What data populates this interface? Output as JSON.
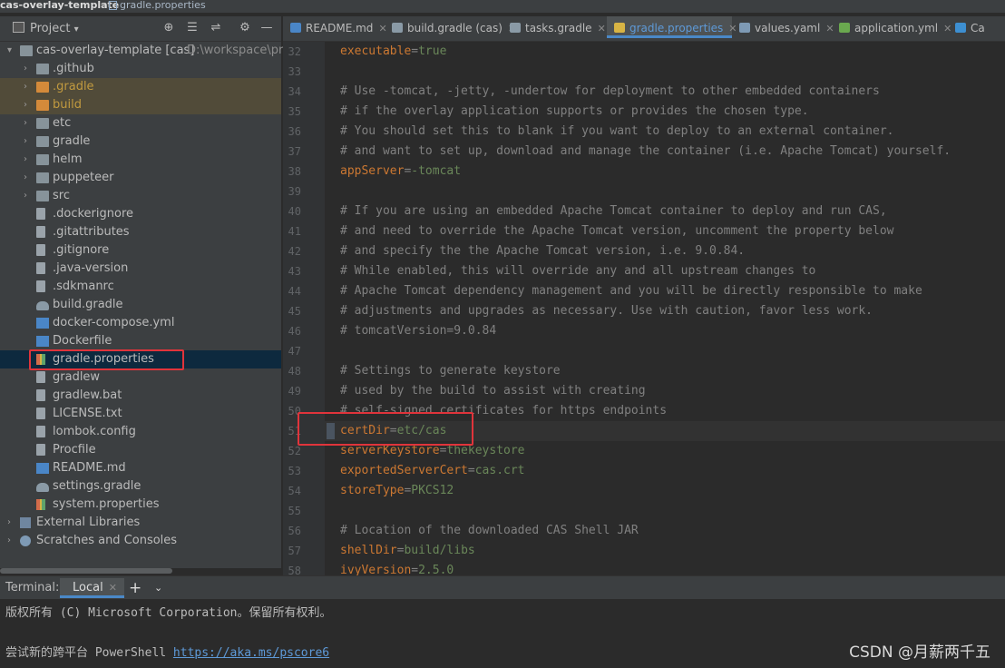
{
  "breadcrumb": {
    "project": "cas-overlay-template",
    "file": "gradle.properties"
  },
  "project_panel": {
    "title": "Project",
    "tree": [
      {
        "label": "cas-overlay-template [cas]",
        "extra": "D:\\workspace\\pro",
        "kind": "root"
      },
      {
        "label": ".github",
        "kind": "folder"
      },
      {
        "label": ".gradle",
        "kind": "folder-excluded"
      },
      {
        "label": "build",
        "kind": "folder-excluded"
      },
      {
        "label": "etc",
        "kind": "folder"
      },
      {
        "label": "gradle",
        "kind": "folder"
      },
      {
        "label": "helm",
        "kind": "folder"
      },
      {
        "label": "puppeteer",
        "kind": "folder"
      },
      {
        "label": "src",
        "kind": "folder"
      },
      {
        "label": ".dockerignore",
        "kind": "file"
      },
      {
        "label": ".gitattributes",
        "kind": "file"
      },
      {
        "label": ".gitignore",
        "kind": "file"
      },
      {
        "label": ".java-version",
        "kind": "file"
      },
      {
        "label": ".sdkmanrc",
        "kind": "file"
      },
      {
        "label": "build.gradle",
        "kind": "gradle"
      },
      {
        "label": "docker-compose.yml",
        "kind": "doc"
      },
      {
        "label": "Dockerfile",
        "kind": "doc"
      },
      {
        "label": "gradle.properties",
        "kind": "props-selected"
      },
      {
        "label": "gradlew",
        "kind": "file"
      },
      {
        "label": "gradlew.bat",
        "kind": "file"
      },
      {
        "label": "LICENSE.txt",
        "kind": "file"
      },
      {
        "label": "lombok.config",
        "kind": "file"
      },
      {
        "label": "Procfile",
        "kind": "file"
      },
      {
        "label": "README.md",
        "kind": "doc"
      },
      {
        "label": "settings.gradle",
        "kind": "gradle"
      },
      {
        "label": "system.properties",
        "kind": "props"
      },
      {
        "label": "External Libraries",
        "kind": "libs"
      },
      {
        "label": "Scratches and Consoles",
        "kind": "scratch"
      }
    ]
  },
  "tabs": [
    {
      "label": "README.md",
      "active": false,
      "icon_color": "#4a86c7"
    },
    {
      "label": "build.gradle (cas)",
      "active": false,
      "icon_color": "#8a9aa6"
    },
    {
      "label": "tasks.gradle",
      "active": false,
      "icon_color": "#8a9aa6"
    },
    {
      "label": "gradle.properties",
      "active": true,
      "icon_color": "#d8b444"
    },
    {
      "label": "values.yaml",
      "active": false,
      "icon_color": "#7e9ab5"
    },
    {
      "label": "application.yml",
      "active": false,
      "icon_color": "#6aa84f"
    },
    {
      "label": "Ca",
      "active": false,
      "icon_color": "#3d8fd1"
    }
  ],
  "editor": {
    "lines": [
      {
        "n": "32",
        "type": "kv",
        "key": "executable",
        "value": "true"
      },
      {
        "n": "33",
        "type": "blank",
        "text": ""
      },
      {
        "n": "34",
        "type": "comment",
        "text": "# Use -tomcat, -jetty, -undertow for deployment to other embedded containers"
      },
      {
        "n": "35",
        "type": "comment",
        "text": "# if the overlay application supports or provides the chosen type."
      },
      {
        "n": "36",
        "type": "comment",
        "text": "# You should set this to blank if you want to deploy to an external container."
      },
      {
        "n": "37",
        "type": "comment",
        "text": "# and want to set up, download and manage the container (i.e. Apache Tomcat) yourself."
      },
      {
        "n": "38",
        "type": "kv",
        "key": "appServer",
        "value": "-tomcat"
      },
      {
        "n": "39",
        "type": "blank",
        "text": ""
      },
      {
        "n": "40",
        "type": "comment",
        "text": "# If you are using an embedded Apache Tomcat container to deploy and run CAS,"
      },
      {
        "n": "41",
        "type": "comment",
        "text": "# and need to override the Apache Tomcat version, uncomment the property below"
      },
      {
        "n": "42",
        "type": "comment",
        "text": "# and specify the the Apache Tomcat version, i.e. 9.0.84."
      },
      {
        "n": "43",
        "type": "comment",
        "text": "# While enabled, this will override any and all upstream changes to"
      },
      {
        "n": "44",
        "type": "comment",
        "text": "# Apache Tomcat dependency management and you will be directly responsible to make"
      },
      {
        "n": "45",
        "type": "comment",
        "text": "# adjustments and upgrades as necessary. Use with caution, favor less work."
      },
      {
        "n": "46",
        "type": "comment",
        "text": "# tomcatVersion=9.0.84"
      },
      {
        "n": "47",
        "type": "blank",
        "text": ""
      },
      {
        "n": "48",
        "type": "comment",
        "text": "# Settings to generate keystore"
      },
      {
        "n": "49",
        "type": "comment",
        "text": "# used by the build to assist with creating"
      },
      {
        "n": "50",
        "type": "comment",
        "text": "# self-signed certificates for https endpoints"
      },
      {
        "n": "51",
        "type": "kv",
        "key": "certDir",
        "value": "etc/cas"
      },
      {
        "n": "52",
        "type": "kv",
        "key": "serverKeystore",
        "value": "thekeystore"
      },
      {
        "n": "53",
        "type": "kv",
        "key": "exportedServerCert",
        "value": "cas.crt"
      },
      {
        "n": "54",
        "type": "kv",
        "key": "storeType",
        "value": "PKCS12"
      },
      {
        "n": "55",
        "type": "blank",
        "text": ""
      },
      {
        "n": "56",
        "type": "comment",
        "text": "# Location of the downloaded CAS Shell JAR"
      },
      {
        "n": "57",
        "type": "kv",
        "key": "shellDir",
        "value": "build/libs"
      },
      {
        "n": "58",
        "type": "kv",
        "key": "ivyVersion",
        "value": "2.5.0"
      }
    ]
  },
  "terminal": {
    "title": "Terminal:",
    "tab_label": "Local",
    "add_symbol": "+",
    "copyright": "版权所有 (C) Microsoft Corporation。保留所有权利。",
    "try_prefix": "尝试新的跨平台 PowerShell ",
    "try_link": "https://aka.ms/pscore6"
  },
  "watermark": "CSDN @月薪两千五",
  "colors": {
    "keyword": "#cc7832",
    "value": "#6a8759",
    "comment": "#808080",
    "highlight": "#e0343b"
  }
}
